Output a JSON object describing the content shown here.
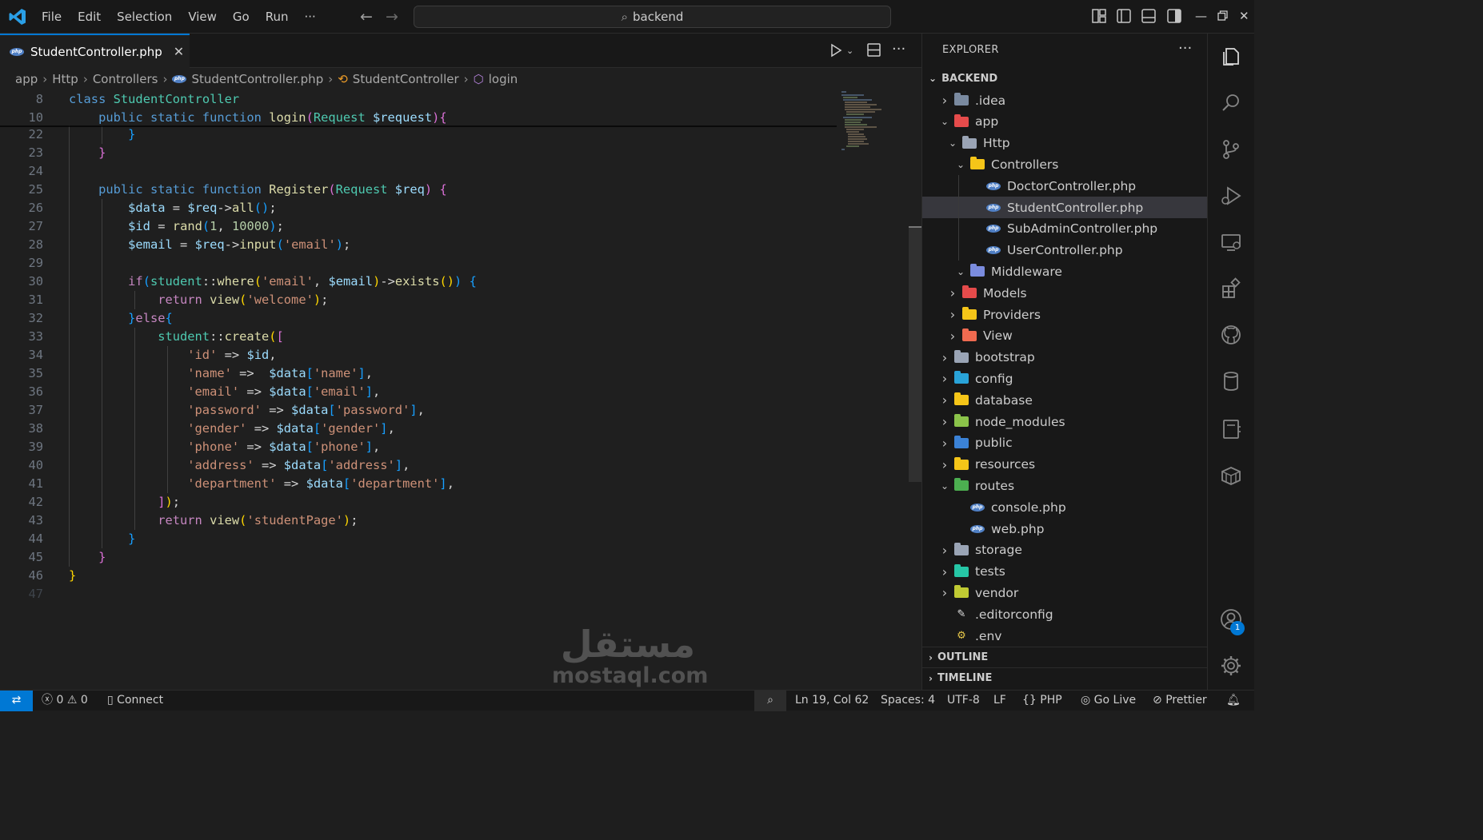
{
  "titlebar": {
    "menu": [
      "File",
      "Edit",
      "Selection",
      "View",
      "Go",
      "Run",
      "···"
    ],
    "search_text": "backend"
  },
  "tab": {
    "label": "StudentController.php"
  },
  "breadcrumb": [
    "app",
    "Http",
    "Controllers",
    "StudentController.php",
    "StudentController",
    "login"
  ],
  "editor": {
    "line_numbers": [
      "8",
      "10",
      "22",
      "23",
      "24",
      "25",
      "26",
      "27",
      "28",
      "29",
      "30",
      "31",
      "32",
      "33",
      "34",
      "35",
      "36",
      "37",
      "38",
      "39",
      "40",
      "41",
      "42",
      "43",
      "44",
      "45",
      "46",
      "47"
    ]
  },
  "explorer": {
    "title": "EXPLORER",
    "root": "BACKEND",
    "items": [
      {
        "label": ".idea",
        "depth": 0,
        "expanded": false,
        "kind": "folder",
        "color": "#7a8aa0"
      },
      {
        "label": "app",
        "depth": 0,
        "expanded": true,
        "kind": "folder",
        "color": "#e54b4b"
      },
      {
        "label": "Http",
        "depth": 1,
        "expanded": true,
        "kind": "folder",
        "color": "#9aa4b5"
      },
      {
        "label": "Controllers",
        "depth": 2,
        "expanded": true,
        "kind": "folder",
        "color": "#f5c518"
      },
      {
        "label": "DoctorController.php",
        "depth": 3,
        "kind": "php"
      },
      {
        "label": "StudentController.php",
        "depth": 3,
        "kind": "php",
        "selected": true
      },
      {
        "label": "SubAdminController.php",
        "depth": 3,
        "kind": "php"
      },
      {
        "label": "UserController.php",
        "depth": 3,
        "kind": "php"
      },
      {
        "label": "Middleware",
        "depth": 2,
        "expanded": true,
        "kind": "folder",
        "color": "#7b8cde"
      },
      {
        "label": "Models",
        "depth": 1,
        "expanded": false,
        "kind": "folder",
        "color": "#e54b4b"
      },
      {
        "label": "Providers",
        "depth": 1,
        "expanded": false,
        "kind": "folder",
        "color": "#f5c518"
      },
      {
        "label": "View",
        "depth": 1,
        "expanded": false,
        "kind": "folder",
        "color": "#ef6a50"
      },
      {
        "label": "bootstrap",
        "depth": 0,
        "expanded": false,
        "kind": "folder",
        "color": "#9aa4b5"
      },
      {
        "label": "config",
        "depth": 0,
        "expanded": false,
        "kind": "folder",
        "color": "#29a3d8"
      },
      {
        "label": "database",
        "depth": 0,
        "expanded": false,
        "kind": "folder",
        "color": "#f5c518"
      },
      {
        "label": "node_modules",
        "depth": 0,
        "expanded": false,
        "kind": "folder",
        "color": "#8bc34a"
      },
      {
        "label": "public",
        "depth": 0,
        "expanded": false,
        "kind": "folder",
        "color": "#3b82d6"
      },
      {
        "label": "resources",
        "depth": 0,
        "expanded": false,
        "kind": "folder",
        "color": "#f5c518"
      },
      {
        "label": "routes",
        "depth": 0,
        "expanded": true,
        "kind": "folder",
        "color": "#4caf50"
      },
      {
        "label": "console.php",
        "depth": 1,
        "kind": "php"
      },
      {
        "label": "web.php",
        "depth": 1,
        "kind": "php"
      },
      {
        "label": "storage",
        "depth": 0,
        "expanded": false,
        "kind": "folder",
        "color": "#9aa4b5"
      },
      {
        "label": "tests",
        "depth": 0,
        "expanded": false,
        "kind": "folder",
        "color": "#26c6a6"
      },
      {
        "label": "vendor",
        "depth": 0,
        "expanded": false,
        "kind": "folder",
        "color": "#c0ca33"
      },
      {
        "label": ".editorconfig",
        "depth": 0,
        "kind": "editorconfig"
      },
      {
        "label": ".env",
        "depth": 0,
        "kind": "env"
      }
    ],
    "outline": "OUTLINE",
    "timeline": "TIMELINE"
  },
  "statusbar": {
    "errors": "0",
    "warnings": "0",
    "connect": "Connect",
    "position": "Ln 19, Col 62",
    "spaces": "Spaces: 4",
    "encoding": "UTF-8",
    "eol": "LF",
    "language": "PHP",
    "golive": "Go Live",
    "prettier": "Prettier"
  },
  "account_badge": "1",
  "watermark": {
    "arabic": "مستقل",
    "latin": "mostaql.com"
  }
}
